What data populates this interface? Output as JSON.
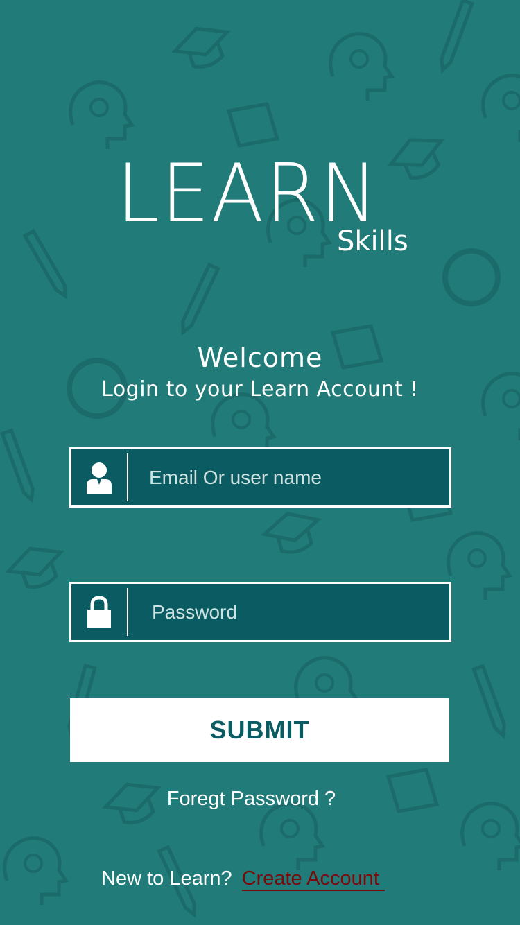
{
  "colors": {
    "background": "#217b78",
    "field_background": "#0b5c62",
    "accent_text": "#0b5c62",
    "link": "#7a0a0a",
    "white": "#ffffff"
  },
  "logo": {
    "main": "LEARN",
    "sub": "Skills"
  },
  "welcome": {
    "title": "Welcome",
    "subtitle": "Login to your Learn Account !"
  },
  "form": {
    "email": {
      "icon": "user-icon",
      "placeholder": "Email Or user name",
      "value": ""
    },
    "password": {
      "icon": "lock-icon",
      "placeholder": "Password",
      "value": ""
    },
    "submit_label": "SUBMIT"
  },
  "forgot_label": "Foregt Password ?",
  "signup": {
    "prompt": "New to Learn?",
    "link_label": "Create Account"
  }
}
